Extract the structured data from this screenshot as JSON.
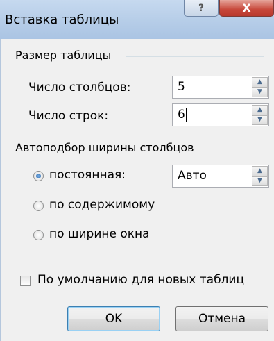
{
  "dialog": {
    "title": "Вставка таблицы",
    "help_label": "?",
    "close_label": "X"
  },
  "table_size": {
    "group_label": "Размер таблицы",
    "columns_label": "Число столбцов:",
    "columns_value": "5",
    "rows_label": "Число строк:",
    "rows_value": "6"
  },
  "autofit": {
    "group_label": "Автоподбор ширины столбцов",
    "options": [
      {
        "label": "постоянная:",
        "checked": true
      },
      {
        "label": "по содержимому",
        "checked": false
      },
      {
        "label": "по ширине окна",
        "checked": false
      }
    ],
    "fixed_width_value": "Авто"
  },
  "default_checkbox_label": "По умолчанию для новых таблиц",
  "buttons": {
    "ok": "OK",
    "cancel": "Отмена"
  },
  "icons": {
    "spin_up": "triangle-up",
    "spin_down": "triangle-down"
  }
}
